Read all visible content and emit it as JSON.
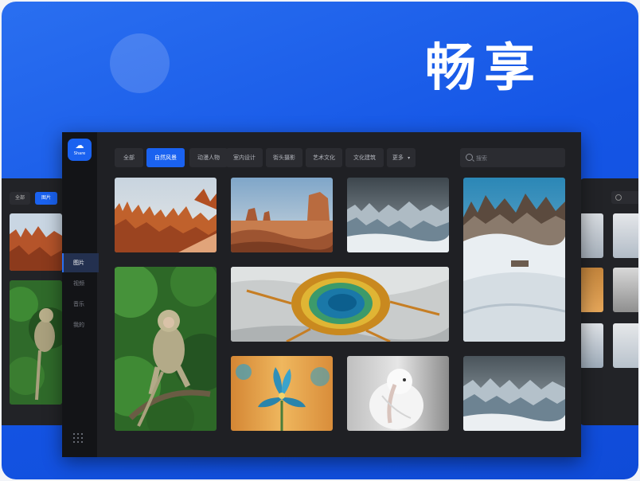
{
  "headline": "畅享",
  "app": {
    "logo_text": "Share",
    "nav": [
      {
        "label": "图片",
        "active": true
      },
      {
        "label": "视频",
        "active": false
      },
      {
        "label": "音乐",
        "active": false
      },
      {
        "label": "我的",
        "active": false
      }
    ],
    "tabs": [
      {
        "label": "全部",
        "active": false
      },
      {
        "label": "自然风景",
        "active": true
      },
      {
        "label": "动漫人物",
        "active": false
      },
      {
        "label": "室内设计",
        "active": false
      },
      {
        "label": "街头摄影",
        "active": false
      },
      {
        "label": "艺术文化",
        "active": false
      },
      {
        "label": "文化建筑",
        "active": false
      },
      {
        "label": "更多",
        "active": false
      }
    ],
    "more_caret": "▾",
    "search_placeholder": "搜索"
  },
  "ghost": {
    "tab_all": "全部",
    "tab_photo": "图片"
  },
  "photos": [
    "canyon-hoodoos",
    "desert-buttes",
    "ice-glacier",
    "snowy-peaks",
    "monkey-tree",
    "hot-spring-aerial",
    "blue-iris-flower",
    "white-bird",
    "ice-glacier-2"
  ]
}
